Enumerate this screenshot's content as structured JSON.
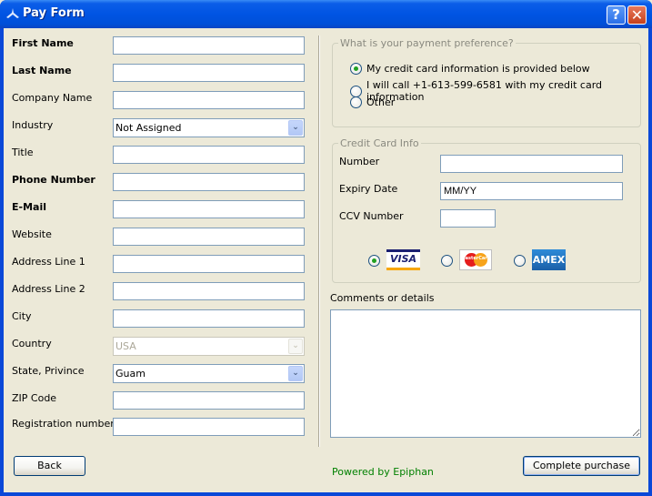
{
  "window": {
    "title": "Pay Form",
    "help_button": "?",
    "close_button": "✕"
  },
  "left_form": {
    "fields": [
      {
        "label": "First Name",
        "required": true,
        "value": ""
      },
      {
        "label": "Last Name",
        "required": true,
        "value": ""
      },
      {
        "label": "Company Name",
        "required": false,
        "value": ""
      },
      {
        "label": "Industry",
        "required": false,
        "type": "combo",
        "value": "Not Assigned"
      },
      {
        "label": "Title",
        "required": false,
        "value": ""
      },
      {
        "label": "Phone Number",
        "required": true,
        "value": ""
      },
      {
        "label": "E-Mail",
        "required": true,
        "value": ""
      },
      {
        "label": "Website",
        "required": false,
        "value": ""
      },
      {
        "label": "Address Line 1",
        "required": false,
        "value": ""
      },
      {
        "label": "Address Line 2",
        "required": false,
        "value": ""
      },
      {
        "label": "City",
        "required": false,
        "value": ""
      },
      {
        "label": "Country",
        "required": false,
        "type": "combo",
        "disabled": true,
        "value": "USA"
      },
      {
        "label": "State, Privince",
        "required": false,
        "type": "combo",
        "value": "Guam"
      },
      {
        "label": "ZIP Code",
        "required": false,
        "value": ""
      },
      {
        "label": "Registration number",
        "required": false,
        "value": ""
      }
    ]
  },
  "payment_preference": {
    "title": "What is your payment preference?",
    "options": [
      {
        "label": "My credit card information is provided below",
        "checked": true
      },
      {
        "label": "I will call +1-613-599-6581 with my credit card information",
        "checked": false
      },
      {
        "label": "Other",
        "checked": false
      }
    ]
  },
  "credit_card": {
    "title": "Credit Card Info",
    "number_label": "Number",
    "number_value": "",
    "expiry_label": "Expiry Date",
    "expiry_value": "MM/YY",
    "ccv_label": "CCV Number",
    "ccv_value": "",
    "card_types": [
      {
        "name": "VISA",
        "checked": true
      },
      {
        "name": "MasterCard",
        "checked": false
      },
      {
        "name": "AMEX",
        "checked": false
      }
    ]
  },
  "comments": {
    "label": "Comments or details",
    "value": ""
  },
  "footer": {
    "back_label": "Back",
    "powered_by": "Powered by Epiphan",
    "complete_label": "Complete purchase"
  }
}
